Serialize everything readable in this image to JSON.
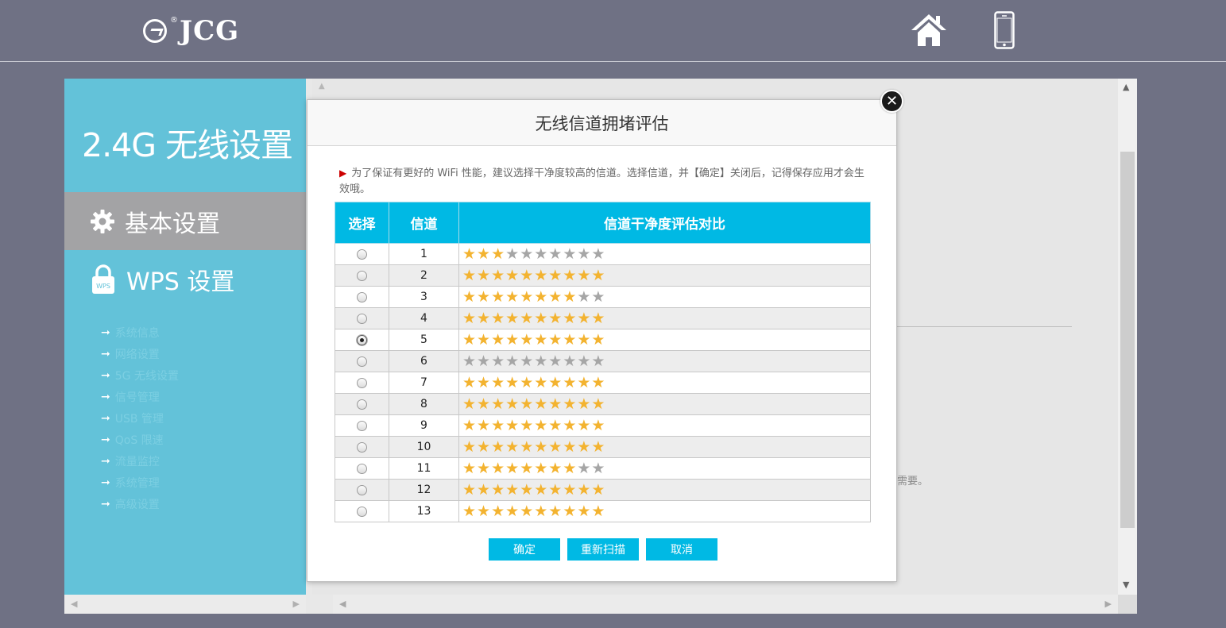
{
  "header": {
    "logo_text": "JCG",
    "logo_reg": "®",
    "icons": {
      "home": "home-icon",
      "phone": "phone-icon"
    }
  },
  "sidebar": {
    "title": "2.4G 无线设置",
    "menu_basic": "基本设置",
    "menu_wps": "WPS 设置",
    "links": [
      "系统信息",
      "网络设置",
      "5G 无线设置",
      "信号管理",
      "USB 管理",
      "QoS 限速",
      "流量监控",
      "系统管理",
      "高级设置"
    ]
  },
  "content": {
    "tail_text": "需要。"
  },
  "modal": {
    "title": "无线信道拥堵评估",
    "notice": "为了保证有更好的 WiFi 性能，建议选择干净度较高的信道。选择信道，并【确定】关闭后，记得保存应用才会生效哦。",
    "table": {
      "headers": [
        "选择",
        "信道",
        "信道干净度评估对比"
      ],
      "max_stars": 10,
      "rows": [
        {
          "channel": "1",
          "stars": 3,
          "selected": false
        },
        {
          "channel": "2",
          "stars": 10,
          "selected": false
        },
        {
          "channel": "3",
          "stars": 8,
          "selected": false
        },
        {
          "channel": "4",
          "stars": 10,
          "selected": false
        },
        {
          "channel": "5",
          "stars": 10,
          "selected": true
        },
        {
          "channel": "6",
          "stars": 0,
          "selected": false
        },
        {
          "channel": "7",
          "stars": 10,
          "selected": false
        },
        {
          "channel": "8",
          "stars": 10,
          "selected": false
        },
        {
          "channel": "9",
          "stars": 10,
          "selected": false
        },
        {
          "channel": "10",
          "stars": 10,
          "selected": false
        },
        {
          "channel": "11",
          "stars": 8,
          "selected": false
        },
        {
          "channel": "12",
          "stars": 10,
          "selected": false
        },
        {
          "channel": "13",
          "stars": 10,
          "selected": false
        }
      ]
    },
    "buttons": {
      "confirm": "确定",
      "rescan": "重新扫描",
      "cancel": "取消"
    }
  },
  "colors": {
    "background": "#6f7184",
    "sidebar": "#63c2d9",
    "accent": "#00b9e4",
    "star_on": "#f3b330",
    "star_off": "#a6a6a6"
  }
}
